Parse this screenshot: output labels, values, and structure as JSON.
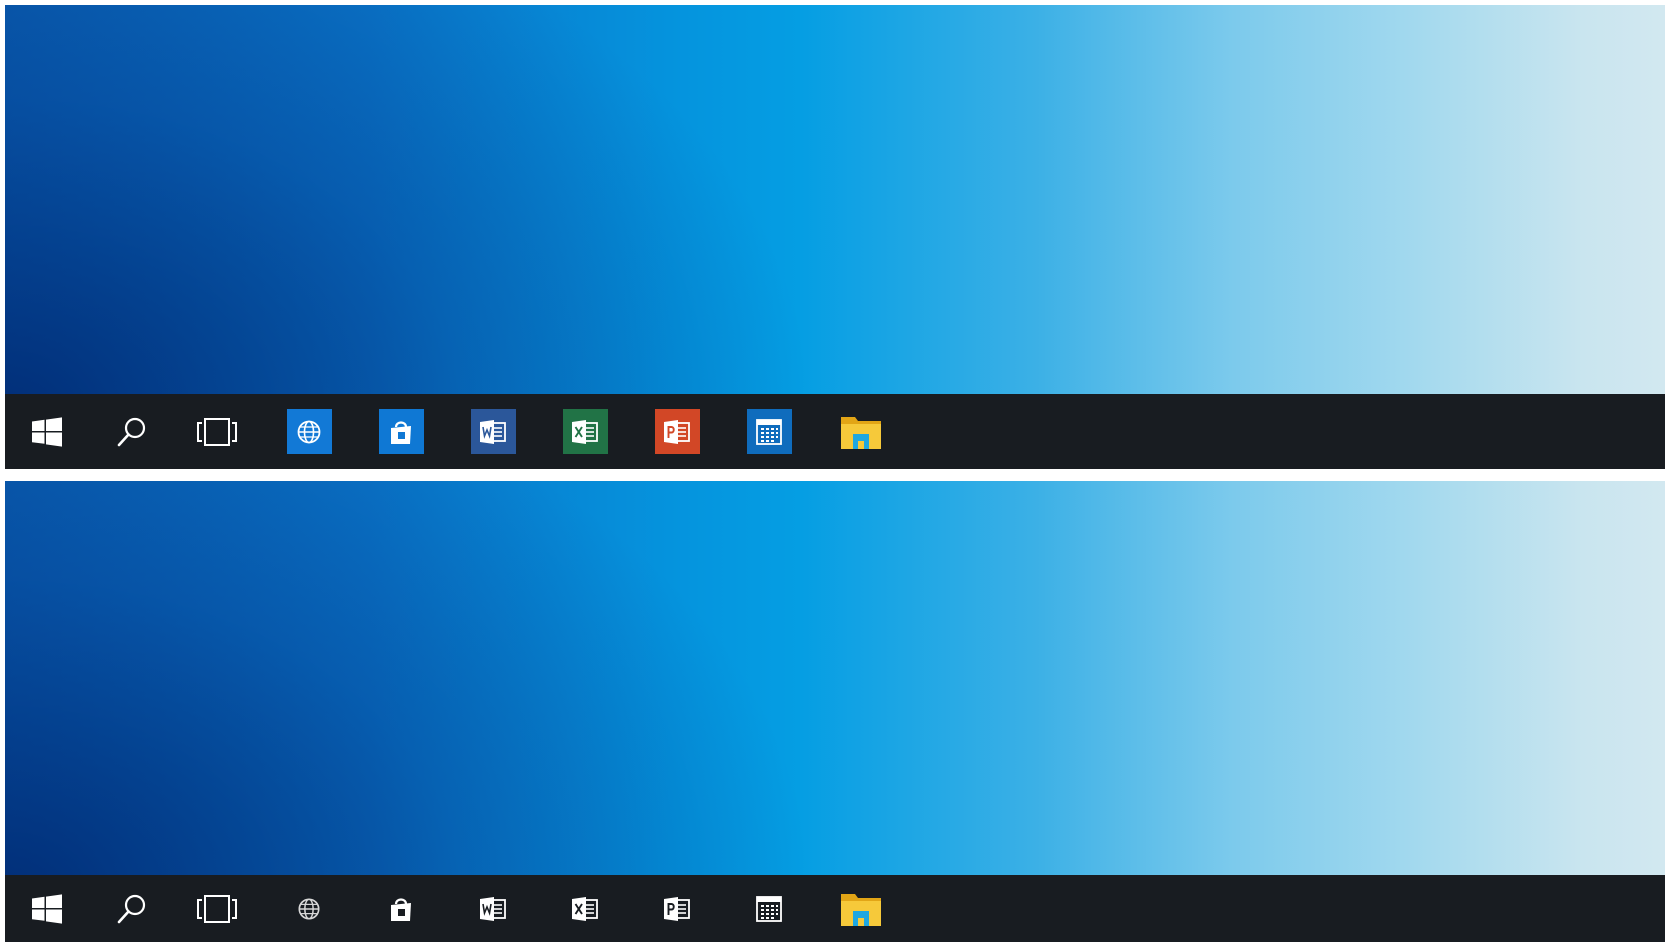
{
  "screenshot": {
    "panels": [
      {
        "id": "top",
        "variant": "colored-tiles",
        "taskbar": {
          "items": [
            {
              "name": "start-button",
              "icon": "windows-logo-icon"
            },
            {
              "name": "search-button",
              "icon": "search-icon"
            },
            {
              "name": "task-view-button",
              "icon": "task-view-icon"
            },
            {
              "name": "edge-browser",
              "icon": "globe-icon",
              "tile_color": "#1279d6"
            },
            {
              "name": "store-app",
              "icon": "shopping-bag-icon",
              "tile_color": "#0f78d4"
            },
            {
              "name": "word-app",
              "icon": "word-icon",
              "tile_color": "#2b579a"
            },
            {
              "name": "excel-app",
              "icon": "excel-icon",
              "tile_color": "#217346"
            },
            {
              "name": "powerpoint-app",
              "icon": "powerpoint-icon",
              "tile_color": "#d24726"
            },
            {
              "name": "calendar-app",
              "icon": "calendar-icon",
              "tile_color": "#0f6cbd"
            },
            {
              "name": "file-explorer",
              "icon": "folder-icon",
              "tile_color": ""
            }
          ]
        }
      },
      {
        "id": "bottom",
        "variant": "plain-icons",
        "taskbar": {
          "items": [
            {
              "name": "start-button",
              "icon": "windows-logo-icon"
            },
            {
              "name": "search-button",
              "icon": "search-icon"
            },
            {
              "name": "task-view-button",
              "icon": "task-view-icon"
            },
            {
              "name": "edge-browser",
              "icon": "globe-icon"
            },
            {
              "name": "store-app",
              "icon": "shopping-bag-icon"
            },
            {
              "name": "word-app",
              "icon": "word-icon"
            },
            {
              "name": "excel-app",
              "icon": "excel-icon"
            },
            {
              "name": "powerpoint-app",
              "icon": "powerpoint-icon"
            },
            {
              "name": "calendar-app",
              "icon": "calendar-icon"
            },
            {
              "name": "file-explorer",
              "icon": "folder-icon"
            }
          ]
        }
      }
    ]
  },
  "colors": {
    "taskbar_background": "#181c21",
    "icon_foreground": "#ffffff",
    "wallpaper_dark": "#0a3f8f",
    "wallpaper_mid": "#059ee3",
    "wallpaper_light": "#d2e8f0",
    "folder_yellow": "#f6c93a",
    "folder_blue": "#1fa7e0"
  }
}
